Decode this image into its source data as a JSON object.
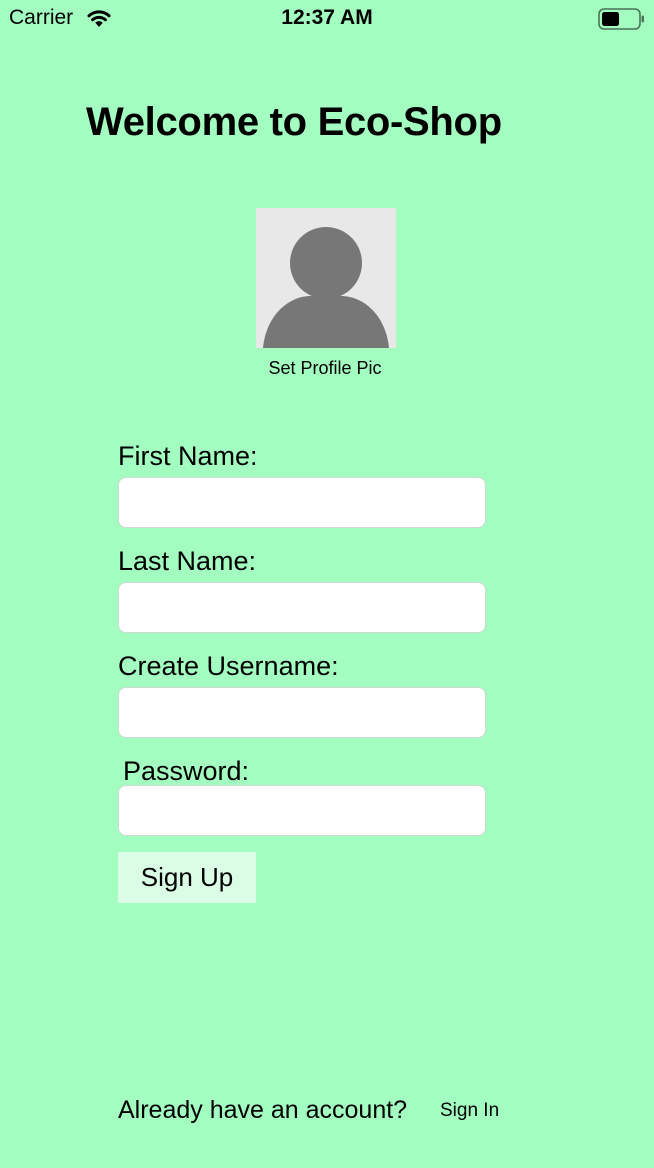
{
  "status_bar": {
    "carrier": "Carrier",
    "time": "12:37 AM",
    "wifi_icon": "wifi-icon",
    "battery_icon": "battery-icon"
  },
  "title": "Welcome to Eco-Shop",
  "profile": {
    "avatar_icon": "person-placeholder-icon",
    "set_pic_label": "Set Profile Pic"
  },
  "form": {
    "first_name_label": "First Name:",
    "first_name_value": "",
    "last_name_label": "Last Name:",
    "last_name_value": "",
    "username_label": "Create Username:",
    "username_value": "",
    "password_label": "Password:",
    "password_value": "",
    "sign_up_label": "Sign Up"
  },
  "footer": {
    "prompt": "Already have an account?",
    "sign_in_label": "Sign In"
  },
  "colors": {
    "background": "#a3fdc0",
    "button_background": "#dbfde6",
    "field_background": "#ffffff",
    "avatar_background": "#e8e8e8",
    "avatar_figure": "#777777"
  }
}
